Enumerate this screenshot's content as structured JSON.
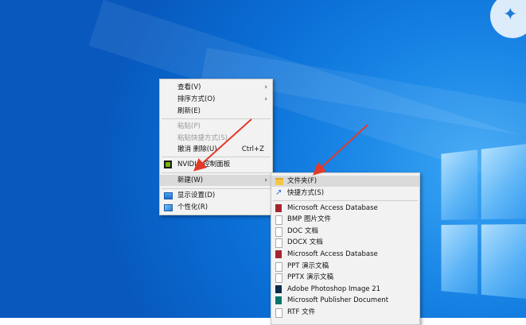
{
  "colors": {
    "menu_bg": "#f2f2f2",
    "highlight": "#dadada",
    "disabled_text": "#9a9a9a",
    "annotation_arrow": "#e23a2a",
    "desktop_blue": "#0a6fd6"
  },
  "context_menu": {
    "view": "查看(V)",
    "sort": "排序方式(O)",
    "refresh": "刷新(E)",
    "paste": "粘贴(P)",
    "paste_shortcut": "粘贴快捷方式(S)",
    "undo_delete": "撤消 删除(U)",
    "undo_shortcut": "Ctrl+Z",
    "nvidia": "NVIDIA 控制面板",
    "new": "新建(W)",
    "display": "显示设置(D)",
    "personalize": "个性化(R)"
  },
  "new_submenu": {
    "folder": "文件夹(F)",
    "shortcut": "快捷方式(S)",
    "access1": "Microsoft Access Database",
    "bmp": "BMP 图片文件",
    "doc": "DOC 文档",
    "docx": "DOCX 文档",
    "access2": "Microsoft Access Database",
    "ppt": "PPT 演示文稿",
    "pptx": "PPTX 演示文稿",
    "psd": "Adobe Photoshop Image 21",
    "pub": "Microsoft Publisher Document",
    "rtf": "RTF 文件"
  },
  "icons": {
    "nvidia": "nvidia-icon",
    "display": "display-settings-icon",
    "personalize": "personalize-icon",
    "folder": "folder-icon",
    "shortcut": "shortcut-icon",
    "access": "access-icon",
    "bmp": "bmp-file-icon",
    "doc": "doc-file-icon",
    "docx": "docx-file-icon",
    "ppt": "ppt-file-icon",
    "pptx": "pptx-file-icon",
    "psd": "photoshop-icon",
    "pub": "publisher-icon",
    "rtf": "rtf-file-icon"
  }
}
